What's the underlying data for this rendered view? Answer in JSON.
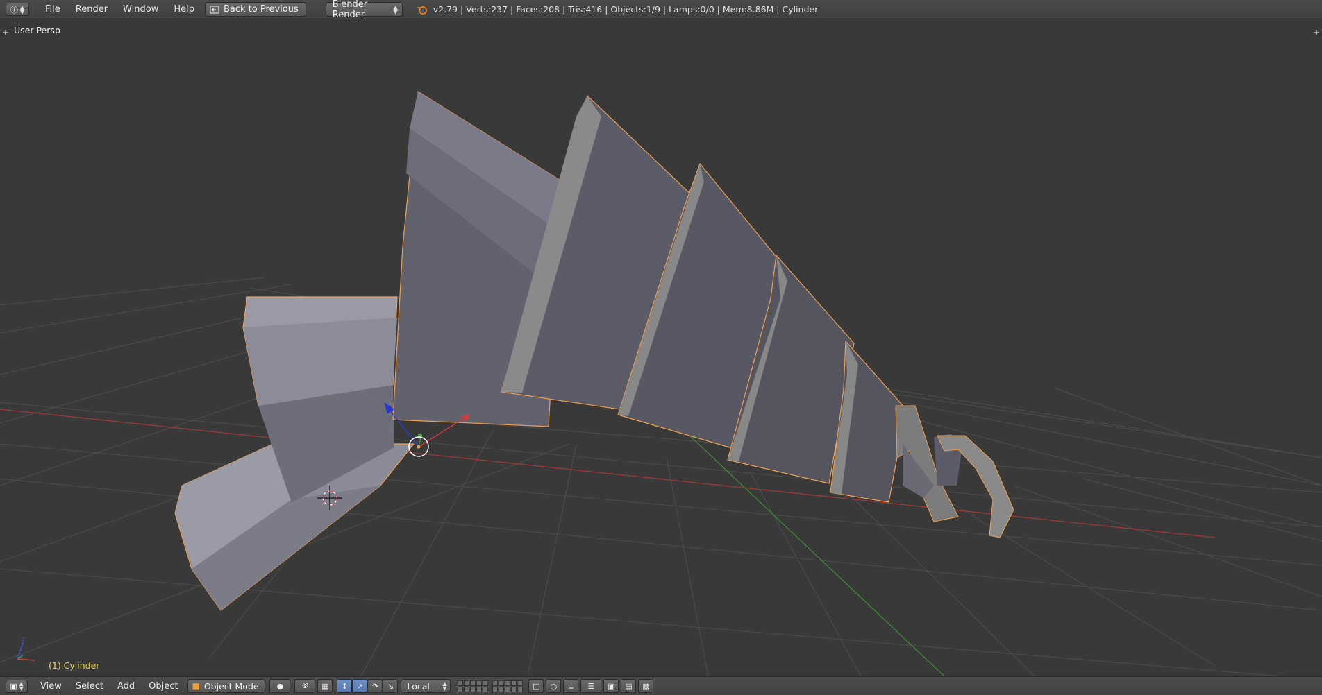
{
  "top": {
    "menus": [
      "File",
      "Render",
      "Window",
      "Help"
    ],
    "back_label": "Back to Previous",
    "render_engine": "Blender Render",
    "stats": "v2.79 | Verts:237 | Faces:208 | Tris:416 | Objects:1/9 | Lamps:0/0 | Mem:8.86M | Cylinder"
  },
  "viewport": {
    "view_name": "User Persp",
    "active_object": "(1) Cylinder"
  },
  "bottom": {
    "menus": [
      "View",
      "Select",
      "Add",
      "Object"
    ],
    "mode": "Object Mode",
    "pivot": "Local"
  },
  "colors": {
    "background": "#393939",
    "grid": "#4c4c4c",
    "x_axis": "#b84040",
    "y_axis": "#4a9a3a",
    "selection_outline": "#f0a050",
    "mesh_light": "#8a8a99",
    "mesh_dark": "#555561"
  },
  "icons": [
    "info-icon",
    "blender-logo-icon",
    "back-icon",
    "viewport-editor-icon",
    "object-mode-icon",
    "shading-sphere-icon",
    "manipulator-icon"
  ]
}
